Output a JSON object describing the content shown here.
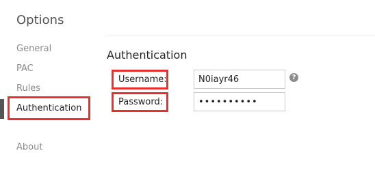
{
  "app": {
    "title": "Options"
  },
  "sidebar": {
    "items": [
      {
        "label": "General"
      },
      {
        "label": "PAC"
      },
      {
        "label": "Rules"
      },
      {
        "label": "Authentication"
      },
      {
        "label": "About"
      }
    ],
    "active": "Authentication"
  },
  "main": {
    "section_title": "Authentication",
    "username": {
      "label": "Username:",
      "value": "N0iayr46"
    },
    "password": {
      "label": "Password:",
      "value": "••••••••••"
    },
    "help_icon": "question-circle-icon"
  },
  "colors": {
    "highlight": "#e5312b",
    "active_marker": "#555555"
  }
}
